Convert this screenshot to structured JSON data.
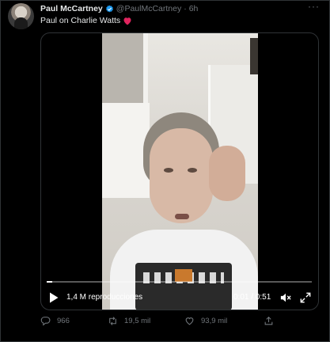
{
  "tweet": {
    "display_name": "Paul McCartney",
    "handle": "@PaulMcCartney",
    "separator": "·",
    "time": "6h",
    "more_label": "···",
    "text": "Paul on Charlie Watts"
  },
  "video": {
    "views": "1,4 M reproducciones",
    "timecode": "0:01 / 0:51",
    "progress": 0.02
  },
  "actions": {
    "replies": "966",
    "retweets": "19,5 mil",
    "likes": "93,9 mil"
  },
  "colors": {
    "background": "#000000",
    "text": "#e7e9ea",
    "muted": "#71767b",
    "verified": "#1d9bf0",
    "border": "#2f3336"
  },
  "icons": [
    "verified-badge-icon",
    "heart-emoji-icon",
    "play-icon",
    "mute-icon",
    "fullscreen-icon",
    "reply-icon",
    "retweet-icon",
    "like-icon",
    "share-icon"
  ]
}
